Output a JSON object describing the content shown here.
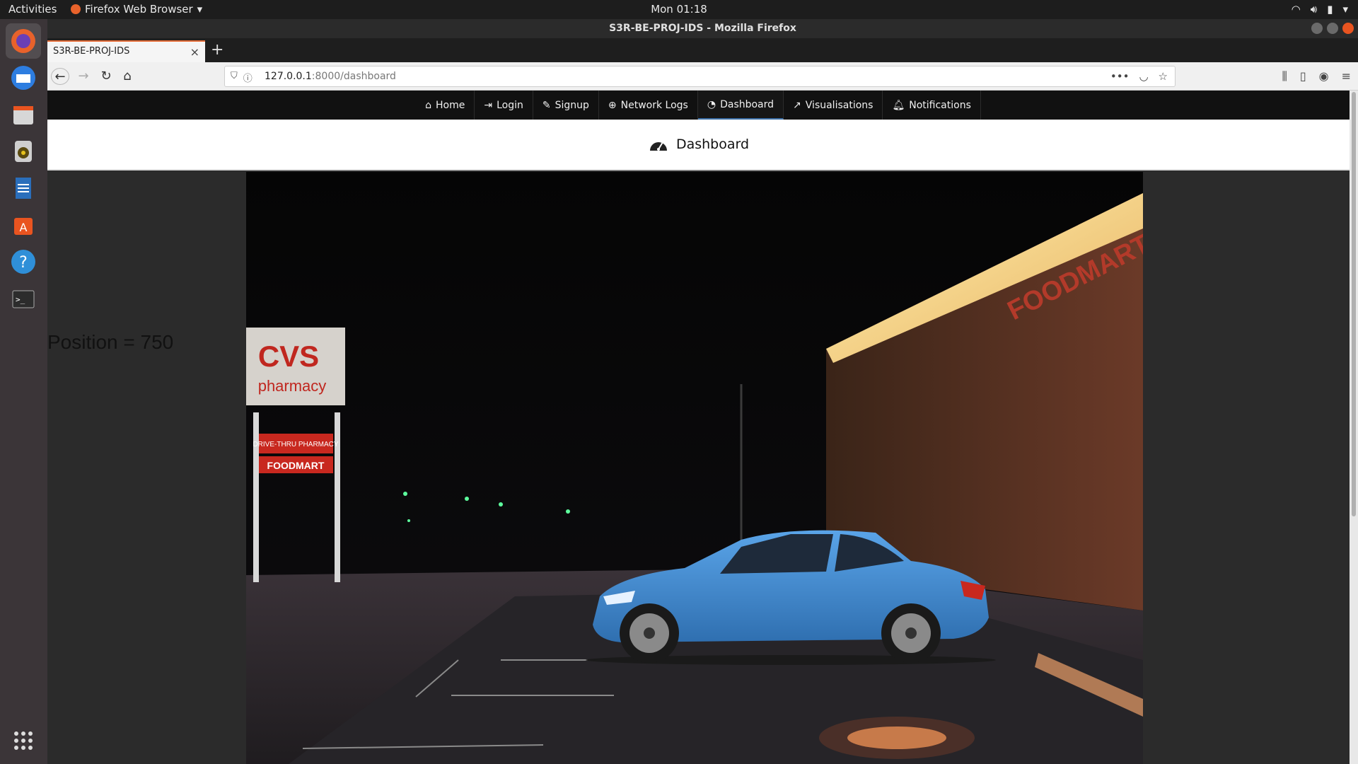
{
  "system": {
    "activities": "Activities",
    "app_name": "Firefox Web Browser",
    "clock": "Mon 01:18"
  },
  "window": {
    "title": "S3R-BE-PROJ-IDS - Mozilla Firefox"
  },
  "browser": {
    "tab_title": "S3R-BE-PROJ-IDS",
    "url_host": "127.0.0.1",
    "url_rest": ":8000/dashboard"
  },
  "site_nav": {
    "items": [
      {
        "label": "Home",
        "icon": "home-icon"
      },
      {
        "label": "Login",
        "icon": "login-icon"
      },
      {
        "label": "Signup",
        "icon": "edit-icon"
      },
      {
        "label": "Network Logs",
        "icon": "globe-icon"
      },
      {
        "label": "Dashboard",
        "icon": "tachometer-icon",
        "active": true
      },
      {
        "label": "Visualisations",
        "icon": "line-chart-icon"
      },
      {
        "label": "Notifications",
        "icon": "bell-icon"
      }
    ]
  },
  "dashboard": {
    "title": "Dashboard",
    "position_text": "Position = 750",
    "store_sign": {
      "brand": "CVS",
      "sub": "pharmacy",
      "panel1": "DRIVE-THRU PHARMACY",
      "panel2": "FOODMART"
    },
    "building_sign": "FOODMART"
  },
  "colors": {
    "accent": "#3b6ea5",
    "car": "#4a90d9",
    "ubuntu_orange": "#e95420"
  }
}
